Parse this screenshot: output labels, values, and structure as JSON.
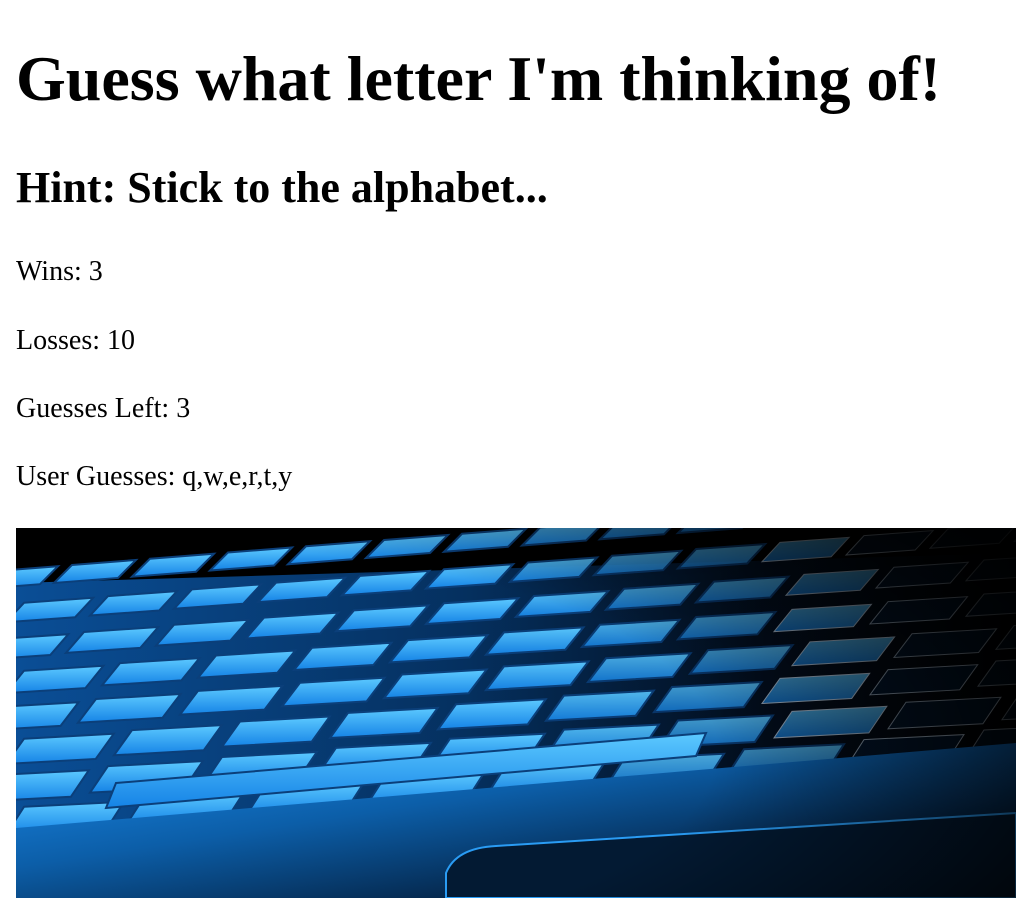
{
  "title": "Guess what letter I'm thinking of!",
  "hint": "Hint: Stick to the alphabet...",
  "stats": {
    "wins_label": "Wins:",
    "wins": "3",
    "losses_label": "Losses:",
    "losses": "10",
    "guesses_left_label": "Guesses Left:",
    "guesses_left": "3",
    "user_guesses_label": "User Guesses:",
    "user_guesses": "q,w,e,r,t,y"
  },
  "image": {
    "subject": "keyboard-photo",
    "colors": {
      "key_light": "#3ab8ff",
      "key_mid": "#0a6fd0",
      "key_dark": "#02284f",
      "chassis": "#0c5ea8",
      "background": "#000000"
    }
  }
}
